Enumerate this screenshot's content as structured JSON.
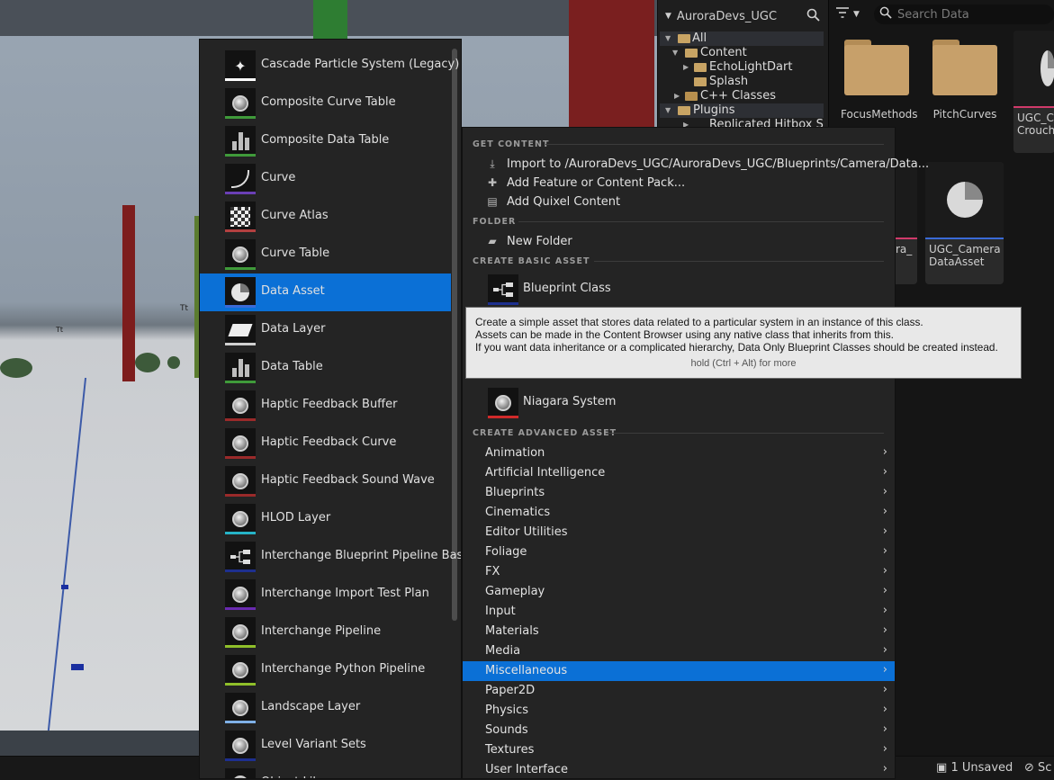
{
  "content_browser": {
    "root_label": "AuroraDevs_UGC",
    "search_placeholder": "Search Data",
    "tree": [
      {
        "label": "All"
      },
      {
        "label": "Content"
      },
      {
        "label": "EchoLightDart"
      },
      {
        "label": "Splash"
      },
      {
        "label": "C++ Classes"
      },
      {
        "label": "Plugins"
      },
      {
        "label": "Replicated Hitbox Sys"
      }
    ],
    "folders": [
      {
        "label": "FocusMethods"
      },
      {
        "label": "PitchCurves"
      }
    ],
    "assets": [
      {
        "label_line1": "UGC_Ca",
        "label_line2": "Crouch"
      },
      {
        "label_line1": "ra_",
        "label_line2": ""
      },
      {
        "label_line1": "UGC_Camera",
        "label_line2": "DataAsset"
      }
    ]
  },
  "status_bar": {
    "unsaved": "1 Unsaved",
    "source_control": "Sc"
  },
  "asset_list": {
    "items": [
      {
        "label": "Cascade Particle System (Legacy)",
        "icon": "sparkle-icon",
        "strip": "#ffffff"
      },
      {
        "label": "Composite Curve Table",
        "icon": "sphere-icon",
        "strip": "#3f9a3a"
      },
      {
        "label": "Composite Data Table",
        "icon": "bars-icon",
        "strip": "#3f9a3a"
      },
      {
        "label": "Curve",
        "icon": "curve-icon",
        "strip": "#6a3fb5"
      },
      {
        "label": "Curve Atlas",
        "icon": "checker-icon",
        "strip": "#b34040"
      },
      {
        "label": "Curve Table",
        "icon": "sphere-icon",
        "strip": "#3f9a3a"
      },
      {
        "label": "Data Asset",
        "icon": "pie-icon",
        "strip": "#3a6ad6"
      },
      {
        "label": "Data Layer",
        "icon": "layers-icon",
        "strip": "#d0d0d0"
      },
      {
        "label": "Data Table",
        "icon": "bars-icon",
        "strip": "#3f9a3a"
      },
      {
        "label": "Haptic Feedback Buffer",
        "icon": "sphere-icon",
        "strip": "#9a2a2a"
      },
      {
        "label": "Haptic Feedback Curve",
        "icon": "sphere-icon",
        "strip": "#9a2a2a"
      },
      {
        "label": "Haptic Feedback Sound Wave",
        "icon": "sphere-icon",
        "strip": "#9a2a2a"
      },
      {
        "label": "HLOD Layer",
        "icon": "sphere-icon",
        "strip": "#26b3c7"
      },
      {
        "label": "Interchange Blueprint Pipeline Base",
        "icon": "nodes-icon",
        "strip": "#1d2f8f"
      },
      {
        "label": "Interchange Import Test Plan",
        "icon": "sphere-icon",
        "strip": "#6a2ab0"
      },
      {
        "label": "Interchange Pipeline",
        "icon": "sphere-icon",
        "strip": "#8fbf2a"
      },
      {
        "label": "Interchange Python Pipeline",
        "icon": "sphere-icon",
        "strip": "#8fbf2a"
      },
      {
        "label": "Landscape Layer",
        "icon": "sphere-icon",
        "strip": "#7fb0e6"
      },
      {
        "label": "Level Variant Sets",
        "icon": "sphere-icon",
        "strip": "#1d2f8f"
      },
      {
        "label": "Object Library",
        "icon": "sphere-icon",
        "strip": "#808080"
      }
    ],
    "selected_index": 6
  },
  "create_menu": {
    "sections": {
      "get_content": "GET CONTENT",
      "folder": "FOLDER",
      "basic": "CREATE BASIC ASSET",
      "advanced": "CREATE ADVANCED ASSET"
    },
    "get_content_items": [
      {
        "label": "Import to /AuroraDevs_UGC/AuroraDevs_UGC/Blueprints/Camera/Data...",
        "icon": "import-icon"
      },
      {
        "label": "Add Feature or Content Pack...",
        "icon": "feature-pack-icon"
      },
      {
        "label": "Add Quixel Content",
        "icon": "quixel-icon"
      }
    ],
    "folder_items": [
      {
        "label": "New Folder",
        "icon": "new-folder-icon"
      }
    ],
    "basic_items": [
      {
        "label": "Blueprint Class",
        "icon": "nodes-icon",
        "strip": "#1d2f8f"
      },
      {
        "label": "Niagara System",
        "icon": "sphere-icon",
        "strip": "#d02a2a"
      }
    ],
    "advanced_items": [
      "Animation",
      "Artificial Intelligence",
      "Blueprints",
      "Cinematics",
      "Editor Utilities",
      "Foliage",
      "FX",
      "Gameplay",
      "Input",
      "Materials",
      "Media",
      "Miscellaneous",
      "Paper2D",
      "Physics",
      "Sounds",
      "Textures",
      "User Interface"
    ],
    "advanced_selected_index": 11
  },
  "tooltip": {
    "lines": [
      "Create a simple asset that stores data related to a particular system in an instance of this class.",
      "Assets can be made in the Content Browser using any native class that inherits from this.",
      "If you want data inheritance or a complicated hierarchy, Data Only Blueprint Classes should be created instead."
    ],
    "hint": "hold (Ctrl + Alt) for more"
  },
  "colors": {
    "selection": "#0b70d6",
    "menu_bg": "#242424",
    "tooltip_bg": "#e8e8e8"
  }
}
